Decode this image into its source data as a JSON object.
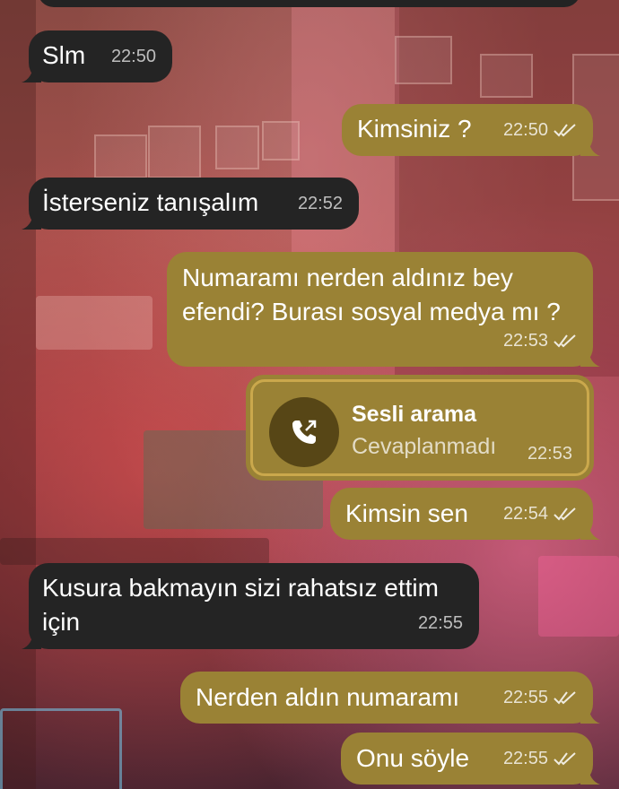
{
  "chat": {
    "messages": [
      {
        "dir": "in",
        "text": "Slm",
        "time": "22:50"
      },
      {
        "dir": "out",
        "text": "Kimsiniz ?",
        "time": "22:50"
      },
      {
        "dir": "in",
        "text": "İsterseniz tanışalım",
        "time": "22:52"
      },
      {
        "dir": "out",
        "text": "Numaramı nerden aldınız bey efendi? Burası sosyal medya mı ?",
        "time": "22:53"
      },
      {
        "dir": "out",
        "text": "Kimsin sen",
        "time": "22:54"
      },
      {
        "dir": "in",
        "text": "Kusura bakmayın sizi rahatsız ettim için",
        "time": "22:55"
      },
      {
        "dir": "out",
        "text": "Nerden aldın numaramı",
        "time": "22:55"
      },
      {
        "dir": "out",
        "text": "Onu söyle",
        "time": "22:55"
      }
    ],
    "call": {
      "title": "Sesli arama",
      "status": "Cevaplanmadı",
      "time": "22:53",
      "icon": "phone-outgoing-icon"
    }
  },
  "colors": {
    "incoming_bubble": "#242424",
    "outgoing_bubble": "#9a8235",
    "call_border": "#caa84c"
  }
}
